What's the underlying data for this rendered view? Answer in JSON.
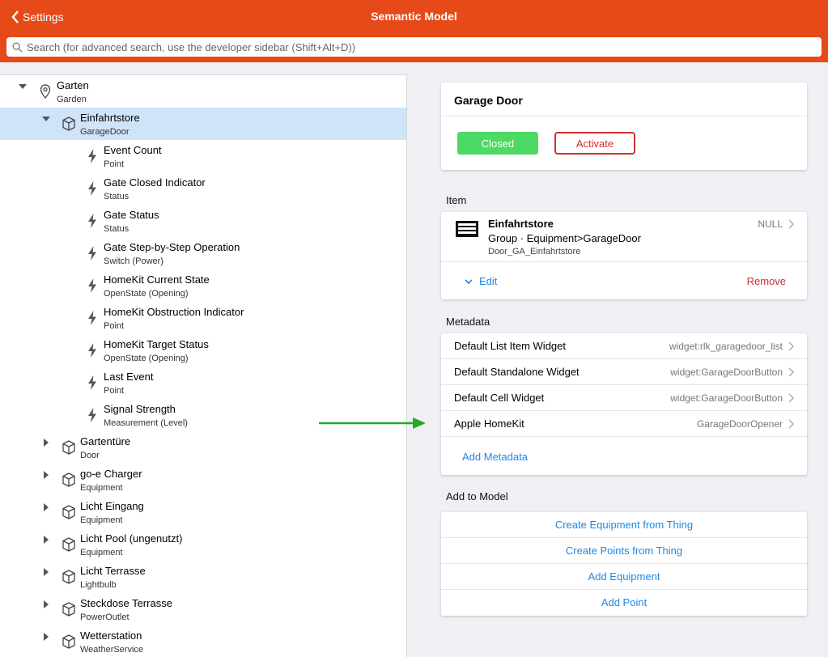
{
  "header": {
    "back_label": "Settings",
    "title": "Semantic Model",
    "search_placeholder": "Search (for advanced search, use the developer sidebar (Shift+Alt+D))"
  },
  "tree": {
    "root": {
      "label": "Garten",
      "sub": "Garden",
      "icon": "location-pin-icon"
    },
    "selected": {
      "label": "Einfahrtstore",
      "sub": "GarageDoor",
      "icon": "cube-icon"
    },
    "points": [
      {
        "label": "Event Count",
        "sub": "Point"
      },
      {
        "label": "Gate Closed Indicator",
        "sub": "Status"
      },
      {
        "label": "Gate Status",
        "sub": "Status"
      },
      {
        "label": "Gate Step-by-Step Operation",
        "sub": "Switch (Power)"
      },
      {
        "label": "HomeKit Current State",
        "sub": "OpenState (Opening)"
      },
      {
        "label": "HomeKit Obstruction Indicator",
        "sub": "Point"
      },
      {
        "label": "HomeKit Target Status",
        "sub": "OpenState (Opening)"
      },
      {
        "label": "Last Event",
        "sub": "Point"
      },
      {
        "label": "Signal Strength",
        "sub": "Measurement (Level)"
      }
    ],
    "siblings": [
      {
        "label": "Gartentüre",
        "sub": "Door"
      },
      {
        "label": "go-e Charger",
        "sub": "Equipment"
      },
      {
        "label": "Licht Eingang",
        "sub": "Equipment"
      },
      {
        "label": "Licht Pool (ungenutzt)",
        "sub": "Equipment"
      },
      {
        "label": "Licht Terrasse",
        "sub": "Lightbulb"
      },
      {
        "label": "Steckdose Terrasse",
        "sub": "PowerOutlet"
      },
      {
        "label": "Wetterstation",
        "sub": "WeatherService"
      }
    ]
  },
  "widget_card": {
    "title": "Garage Door",
    "state_button": "Closed",
    "activate_button": "Activate"
  },
  "item_section": {
    "heading": "Item",
    "name": "Einfahrtstore",
    "type_line": "Group · Equipment>GarageDoor",
    "id": "Door_GA_Einfahrtstore",
    "state": "NULL",
    "edit_label": "Edit",
    "remove_label": "Remove"
  },
  "metadata_section": {
    "heading": "Metadata",
    "rows": [
      {
        "label": "Default List Item Widget",
        "value": "widget:rlk_garagedoor_list"
      },
      {
        "label": "Default Standalone Widget",
        "value": "widget:GarageDoorButton"
      },
      {
        "label": "Default Cell Widget",
        "value": "widget:GarageDoorButton"
      },
      {
        "label": "Apple HomeKit",
        "value": "GarageDoorOpener"
      }
    ],
    "add_label": "Add Metadata"
  },
  "model_section": {
    "heading": "Add to Model",
    "actions": [
      "Create Equipment from Thing",
      "Create Points from Thing",
      "Add Equipment",
      "Add Point"
    ]
  },
  "colors": {
    "header": "#e64a19",
    "selected_row": "#cfe4f9",
    "closed_button": "#4cd964",
    "danger": "#d32f2f",
    "link": "#1e88e5",
    "arrow": "#22aa22"
  }
}
